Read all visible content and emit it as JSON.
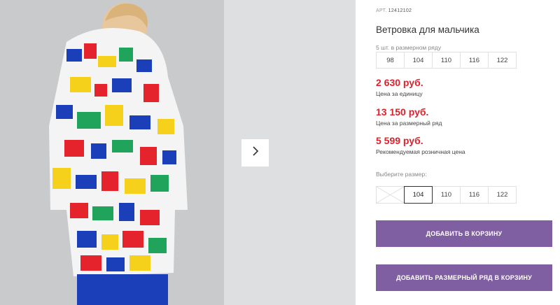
{
  "product": {
    "article_label": "АРТ.",
    "article_number": "12412102",
    "title": "Ветровка для мальчика"
  },
  "series": {
    "label": "5 шт. в размерном ряду",
    "sizes": [
      "98",
      "104",
      "110",
      "116",
      "122"
    ]
  },
  "prices": {
    "unit_price": "2 630 руб.",
    "unit_note": "Цена за единицу",
    "series_price": "13 150 руб.",
    "series_note": "Цена за размерный ряд",
    "retail_price": "5 599 руб.",
    "retail_note": "Рекомендуемая розничная цена"
  },
  "size_picker": {
    "label": "Выберите размер:",
    "options": [
      {
        "size": "98",
        "state": "disabled"
      },
      {
        "size": "104",
        "state": "selected"
      },
      {
        "size": "110",
        "state": "available"
      },
      {
        "size": "116",
        "state": "available"
      },
      {
        "size": "122",
        "state": "available"
      }
    ]
  },
  "buttons": {
    "add_to_cart": "ДОБАВИТЬ В КОРЗИНУ",
    "add_series_to_cart": "ДОБАВИТЬ РАЗМЕРНЫЙ РЯД В КОРЗИНУ"
  },
  "colors": {
    "price_red": "#e0202b",
    "button_purple": "#7f5fa2",
    "jacket_blue": "#1b3fb8",
    "jacket_red": "#e4232d",
    "jacket_yellow": "#f6d11c",
    "jacket_green": "#20a35a"
  },
  "icons": {
    "next": "chevron-right-icon"
  }
}
